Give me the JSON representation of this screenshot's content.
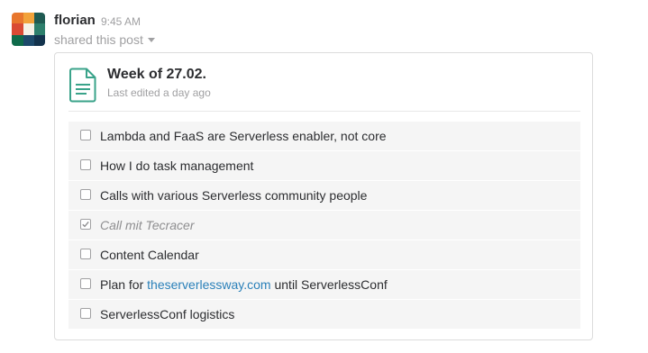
{
  "message": {
    "author": "florian",
    "time": "9:45 AM",
    "shared_text": "shared this post"
  },
  "post": {
    "icon": "document-icon",
    "title": "Week of 27.02.",
    "meta": "Last edited a day ago",
    "tasks": [
      {
        "label": "Lambda and FaaS are Serverless enabler, not core",
        "checked": false
      },
      {
        "label": "How I do task management",
        "checked": false
      },
      {
        "label": "Calls with various Serverless community people",
        "checked": false
      },
      {
        "label": "Call mit Tecracer",
        "checked": true
      },
      {
        "label": "Content Calendar",
        "checked": false
      },
      {
        "label_before": "Plan for ",
        "link": "theserverlessway.com",
        "label_after": " until ServerlessConf",
        "checked": false
      },
      {
        "label": "ServerlessConf logistics",
        "checked": false
      }
    ]
  },
  "colors": {
    "link": "#2a80b9",
    "doc_icon": "#3aa38a",
    "muted": "#a0a0a2"
  }
}
